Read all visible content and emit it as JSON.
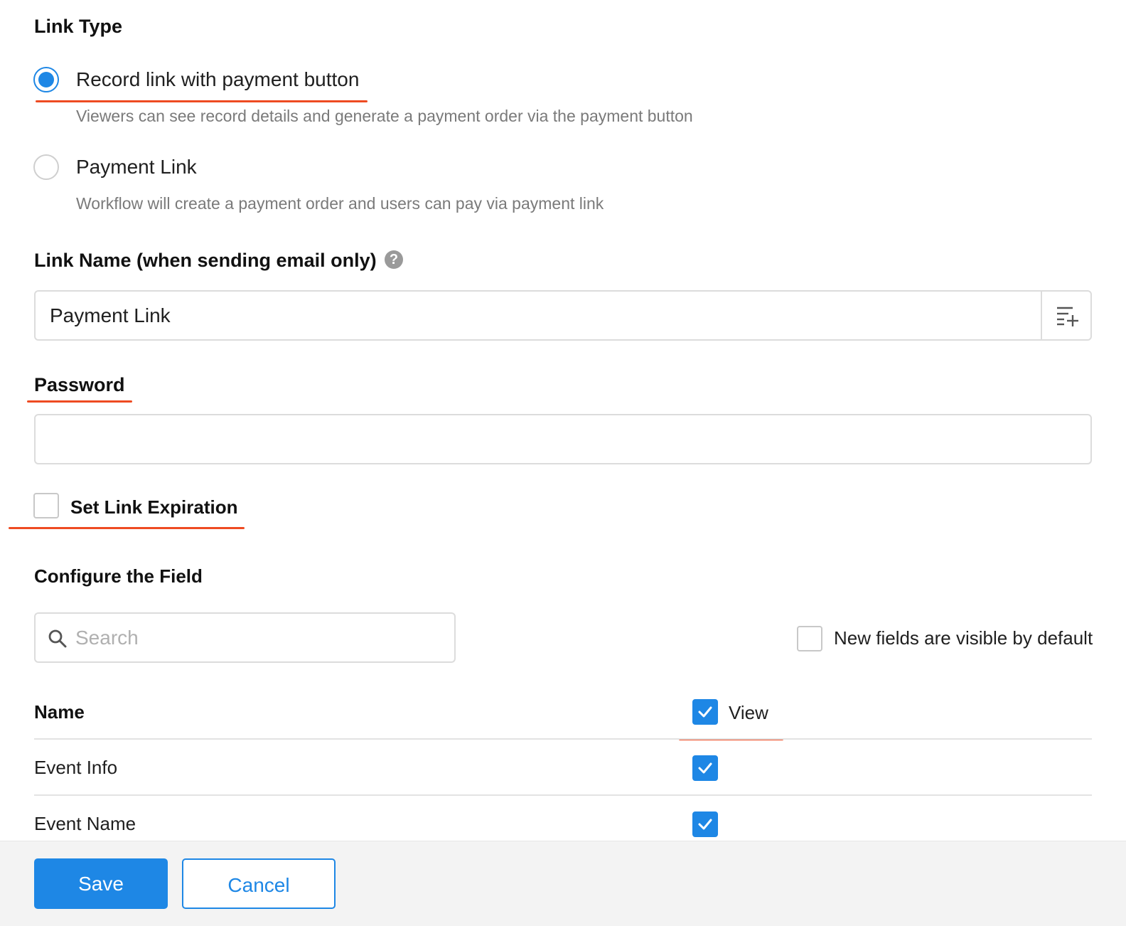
{
  "link_type": {
    "title": "Link Type",
    "options": [
      {
        "label": "Record link with payment button",
        "description": "Viewers can see record details and generate a payment order via the payment button",
        "selected": true
      },
      {
        "label": "Payment Link",
        "description": "Workflow will create a payment order and users can pay via payment link",
        "selected": false
      }
    ]
  },
  "link_name": {
    "title": "Link Name (when sending email only)",
    "help_icon": "?",
    "value": "Payment Link"
  },
  "password": {
    "title": "Password",
    "value": ""
  },
  "expiration": {
    "label": "Set Link Expiration",
    "checked": false
  },
  "configure": {
    "title": "Configure the Field",
    "search_placeholder": "Search",
    "new_fields_label": "New fields are visible by default",
    "new_fields_checked": false,
    "columns": {
      "name": "Name",
      "view": "View"
    },
    "rows": [
      {
        "name": "Event Info",
        "view": true
      },
      {
        "name": "Event Name",
        "view": true
      }
    ]
  },
  "footer": {
    "save_label": "Save",
    "cancel_label": "Cancel"
  },
  "colors": {
    "accent": "#1e87e5",
    "annotation_red": "#ee4b22"
  },
  "icons": {
    "search": "search-icon",
    "insert_field": "insert-field-icon",
    "check": "check-icon",
    "help": "help-icon"
  }
}
